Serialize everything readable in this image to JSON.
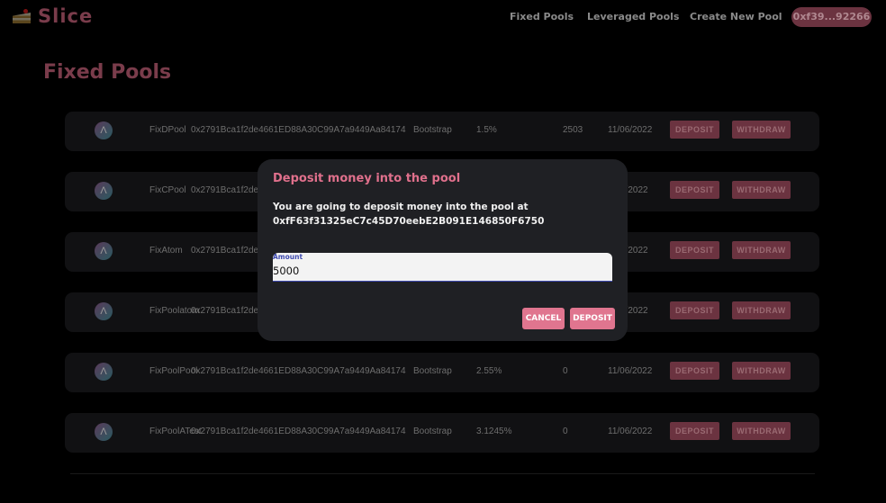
{
  "nav": {
    "brand": "Slice",
    "links": [
      "Fixed Pools",
      "Leveraged Pools",
      "Create New Pool"
    ],
    "wallet": "0xf39...92266"
  },
  "page": {
    "title": "Fixed Pools"
  },
  "pools": [
    {
      "name": "FixDPool",
      "address": "0x2791Bca1f2de4661ED88A30C99A7a9449Aa84174",
      "type": "Bootstrap",
      "rate": "1.5%",
      "count": "2503",
      "date": "11/06/2022"
    },
    {
      "name": "FixCPool",
      "address": "0x2791Bca1f2de",
      "date": "5/2022"
    },
    {
      "name": "FixAtom",
      "address": "0x2791Bca1f2de",
      "date": "5/2022"
    },
    {
      "name": "FixPoolatom",
      "address": "0x2791Bca1f2de",
      "date": "5/2022"
    },
    {
      "name": "FixPoolPool",
      "address": "0x2791Bca1f2de4661ED88A30C99A7a9449Aa84174",
      "type": "Bootstrap",
      "rate": "2.55%",
      "count": "0",
      "date": "11/06/2022"
    },
    {
      "name": "FixPoolATest",
      "address": "0x2791Bca1f2de4661ED88A30C99A7a9449Aa84174",
      "type": "Bootstrap",
      "rate": "3.1245%",
      "count": "0",
      "date": "11/06/2022"
    }
  ],
  "row_actions": {
    "deposit": "DEPOSIT",
    "withdraw": "WITHDRAW"
  },
  "modal": {
    "title": "Deposit money into the pool",
    "text": "You are going to deposit money into the pool at",
    "address": "0xfF63f31325eC7c45D70eebE2B091E146850F6750",
    "amount_label": "Amount",
    "amount_value": "5000",
    "cancel": "CANCEL",
    "deposit": "DEPOSIT"
  },
  "colors": {
    "accent": "#e0758f",
    "dimmed_accent": "#6b3340",
    "modal_bg": "#1f2024"
  }
}
